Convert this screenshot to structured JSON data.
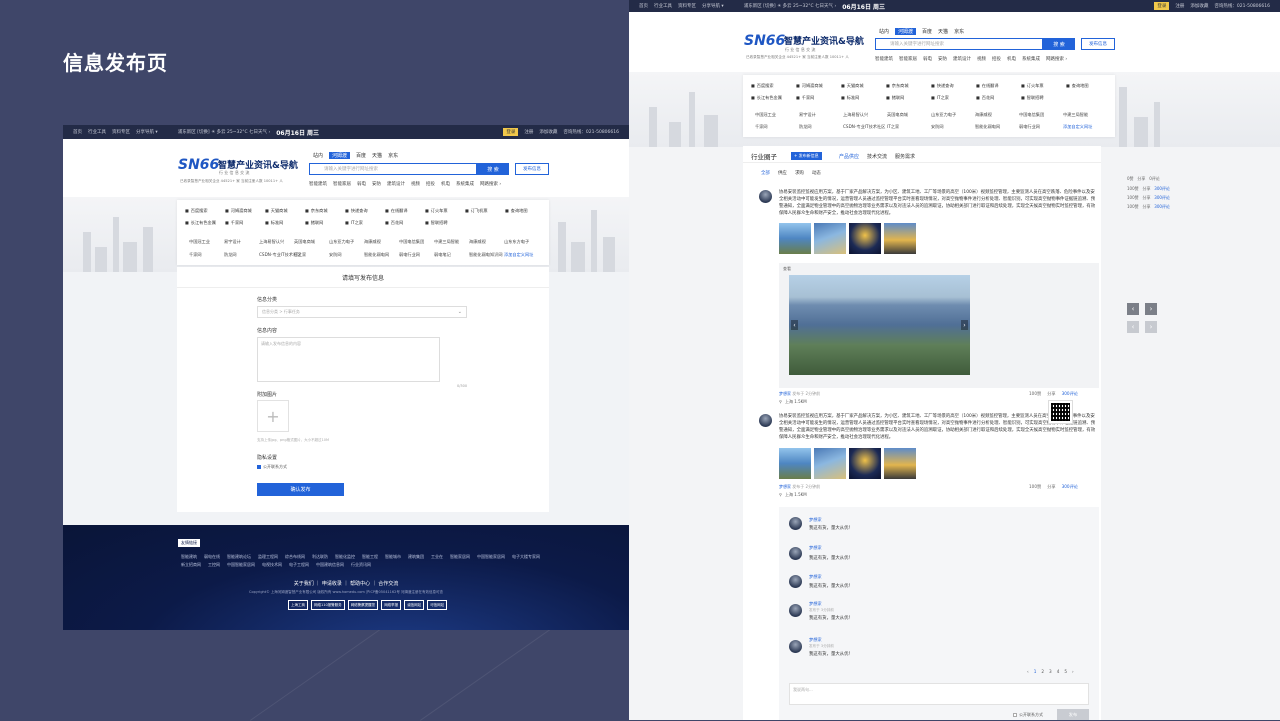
{
  "page": {
    "heading": "信息发布页"
  },
  "site": {
    "topbar": {
      "nav": [
        "首页",
        "行业工具",
        "资料专区",
        "分享导航 ▾"
      ],
      "weather": "浦东新区 [切换]  ☀ 多云 25~32°C  七日天气 ›",
      "date": "06月16日 周三",
      "date_r": "06月16日 周三",
      "login_btn": "登录",
      "register": "注册",
      "bookmark": "添加收藏",
      "hotline": "咨询热线：021-50806616"
    },
    "logo": {
      "mark": "SN66",
      "name": "智慧产业资讯&导航",
      "sub": "行 业 信 息 交 流",
      "tagline": "已收录智慧产业相关企业 44521+ 家    当前注册人数 10011+ 人"
    },
    "search": {
      "tabs": [
        "站内",
        "河姆渡",
        "百度",
        "天猫",
        "京东"
      ],
      "placeholder": "请输入关键字进行网址搜索",
      "button": "搜 索",
      "publish": "发布信息",
      "hot": [
        "智能建筑",
        "智能家居",
        "弱电",
        "安防",
        "建筑设计",
        "视频",
        "招投",
        "机电",
        "系统集成",
        "网路搜索 ›"
      ]
    },
    "quick_links": [
      "百度搜索",
      "河姆渡商城",
      "天猫商城",
      "京东商城",
      "快递查询",
      "在线翻译",
      "订火车票",
      "订飞机票",
      "查询地图",
      "长江有色金属",
      "千家网",
      "标准网",
      "猪联网",
      "IT之家",
      "百花网",
      "智联招聘"
    ],
    "text_links_row1": [
      "中国冠工业",
      "易宇设计",
      "上海易智认兴",
      "英国电商城",
      "山东亚力电子",
      "海康威视",
      "中国电信集团",
      "中建三局智能",
      "海康威视",
      "山东东方电子"
    ],
    "text_links_row2": [
      "千家网",
      "防龙网",
      "CSDN-专业IT技术社区",
      "IT之家",
      "安防网",
      "智能化弱电网",
      "弱电行业网",
      "弱电笔记",
      "智能化弱电知识网",
      "添加自定义网址"
    ]
  },
  "form": {
    "title": "请填写发布信息",
    "category_label": "信息分类",
    "category_placeholder": "信息分类 > 行事任务",
    "content_label": "信息内容",
    "content_placeholder": "请输入发布信息的内容",
    "content_count": "0/300",
    "image_label": "附加图片",
    "image_hint": "支持上传jpg、png格式图片，大小不超过10M",
    "privacy_label": "隐私设置",
    "privacy_option": "公开联系方式",
    "submit": "确认发布"
  },
  "footer": {
    "tag": "友情链接",
    "row1": [
      "智能建筑",
      "弱电在线",
      "智能建筑论坛",
      "监理工程网",
      "综合布线网",
      "利达联防",
      "智能化监控",
      "智能工程",
      "智能城市",
      "建筑集团",
      "工业在",
      "智能家居网",
      "中国智能家居网",
      "电子大楼专家网"
    ],
    "row2": [
      "新立招商网",
      "工控网",
      "中国智能家居网",
      "电视技术网",
      "电子工程网",
      "中国建筑信息网",
      "行业资讯网"
    ],
    "nav": [
      "关于我们",
      "申请收录",
      "帮助中心",
      "合作交流"
    ],
    "copyright": "Copyright© 上海河姆渡智慧产业有限公司 版权所有 www.homedu.com  沪ICP备05041162号  河姆渡注册在有效信息可查",
    "badges": [
      "上海工商",
      "网络110报警服务",
      "网络警察提醒您",
      "网络举报",
      "诚信网站",
      "可信网站"
    ]
  },
  "feed": {
    "section_title": "行业圈子",
    "section_badge": "+ 发布新信息",
    "tabs": [
      "产品供应",
      "技术交流",
      "服务需求"
    ],
    "filters": [
      "全部",
      "供应",
      "求购",
      "动态"
    ],
    "post_text": "协易安装监控监视应用方案，基于厂家产品解决方案，为小区、建筑工地、工厂等场景的高空（100米）视频监控管理，主要监测人员在高空跌落、危险事件以及安全相关活动中可能发生的情况，运营管理人员通过监控管理平台实时查看现场情况，对高空抛物事件进行分析处理、智能识别，可实现高空抛物事件证据链追溯、预警通知，全面满足物业管理中的高空抛物治理等业务需求以及对违法人员的追溯取证，协助相关部门进行取证和后续处理，实现全天候高空抛物实时监控管理，有效保障人民群众生命和财产安全，推动社会治理现代化进程。",
    "poster": "梦想家",
    "poster_time": "发布于 2分钟前",
    "image_label": "查看",
    "location": "上海 1.5KM",
    "actions": [
      "100赞",
      "分享",
      "300评论"
    ],
    "side_stats": [
      [
        "0赞",
        "分享",
        "0评论"
      ],
      [
        "100赞",
        "分享",
        "300评论"
      ],
      [
        "100赞",
        "分享",
        "300评论"
      ],
      [
        "100赞",
        "分享",
        "300评论"
      ]
    ],
    "comments": [
      {
        "name": "梦想家",
        "text": "我这有货，量大从优！",
        "time": "发布于 3分钟前"
      },
      {
        "name": "梦想家",
        "text": "我这有货，量大从优！",
        "time": "发布于 3分钟前"
      },
      {
        "name": "梦想家",
        "text": "我这有货，量大从优！",
        "time": "发布于 3分钟前"
      },
      {
        "name": "梦想家",
        "text": "我这有货，量大从优！",
        "time": "发布于 3分钟前"
      },
      {
        "name": "梦想家",
        "text": "我这有货，量大从优！",
        "time": "发布于 3分钟前"
      }
    ],
    "pager": [
      "‹",
      "1",
      "2",
      "3",
      "4",
      "5",
      "›"
    ],
    "comment_placeholder": "我说两句...",
    "comment_option": "公开联系方式",
    "send": "发布"
  },
  "colors": {
    "accent": "#2263d9",
    "navy": "#232b47",
    "background": "#3f4669"
  }
}
